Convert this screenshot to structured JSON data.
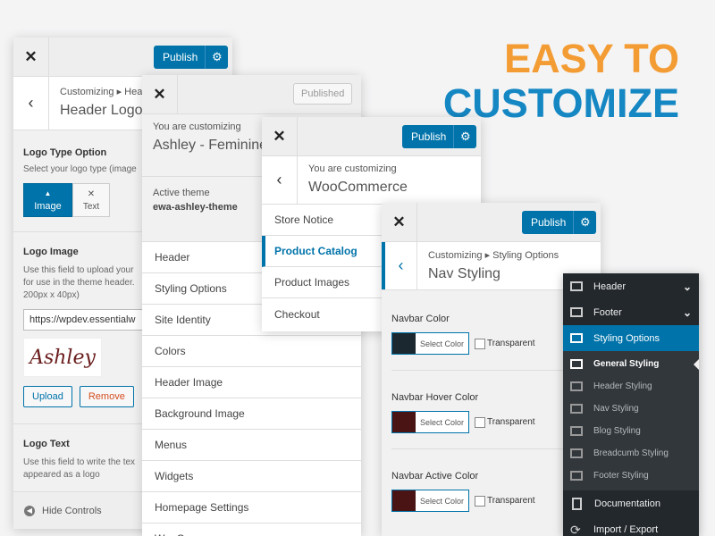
{
  "headline": {
    "line1": "EASY TO",
    "line2": "CUSTOMIZE",
    "color1": "#f39c34",
    "color2": "#1587c3"
  },
  "panel1": {
    "close_icon": "✕",
    "publish_label": "Publish",
    "breadcrumb": "Customizing ▸ Hea",
    "title": "Header Logo",
    "logo_type_label": "Logo Type Option",
    "logo_type_help": "Select your logo type (image",
    "image_button": "Image",
    "text_button": "Text",
    "logo_image_label": "Logo Image",
    "logo_image_help1": "Use this field to upload your",
    "logo_image_help2": "for use in the theme header.",
    "logo_image_help3": "200px x 40px)",
    "url_value": "https://wpdev.essentialw",
    "logo_preview": "Ashley",
    "upload_button": "Upload",
    "remove_button": "Remove",
    "logo_text_label": "Logo Text",
    "logo_text_help1": "Use this field to write the tex",
    "logo_text_help2": "appeared as a logo",
    "hide_controls": "Hide Controls"
  },
  "panel2": {
    "close_icon": "✕",
    "published_label": "Published",
    "customizing_label": "You are customizing",
    "site_title": "Ashley - Feminine",
    "active_theme_label": "Active theme",
    "active_theme_value": "ewa-ashley-theme",
    "items": [
      "Header",
      "Styling Options",
      "Site Identity",
      "Colors",
      "Header Image",
      "Background Image",
      "Menus",
      "Widgets",
      "Homepage Settings",
      "WooCommerce"
    ]
  },
  "panel3": {
    "close_icon": "✕",
    "publish_label": "Publish",
    "customizing_label": "You are customizing",
    "title": "WooCommerce",
    "items": [
      "Store Notice",
      "Product Catalog",
      "Product Images",
      "Checkout"
    ],
    "active_index": 1
  },
  "panel4": {
    "close_icon": "✕",
    "publish_label": "Publish",
    "breadcrumb": "Customizing ▸ Styling Options",
    "title": "Nav Styling",
    "select_color_label": "Select Color",
    "transparent_label": "Transparent",
    "colors": [
      {
        "label": "Navbar Color",
        "swatch": "#1c2830"
      },
      {
        "label": "Navbar Hover Color",
        "swatch": "#4a1414"
      },
      {
        "label": "Navbar Active Color",
        "swatch": "#4a1414"
      }
    ]
  },
  "admin_menu": {
    "items": [
      {
        "label": "Header",
        "icon": "panel-icon",
        "chevron": "chevron-down-icon"
      },
      {
        "label": "Footer",
        "icon": "panel-icon",
        "chevron": "chevron-down-icon"
      },
      {
        "label": "Styling Options",
        "icon": "panel-icon",
        "active": true
      },
      {
        "label": "General Styling",
        "icon": "panel-icon",
        "current": true
      },
      {
        "label": "Header Styling",
        "icon": "panel-icon"
      },
      {
        "label": "Nav Styling",
        "icon": "panel-icon"
      },
      {
        "label": "Blog Styling",
        "icon": "panel-icon"
      },
      {
        "label": "Breadcumb Styling",
        "icon": "panel-icon"
      },
      {
        "label": "Footer Styling",
        "icon": "panel-icon"
      },
      {
        "label": "Documentation",
        "icon": "clipboard-icon"
      },
      {
        "label": "Import / Export",
        "icon": "refresh-icon"
      }
    ]
  }
}
